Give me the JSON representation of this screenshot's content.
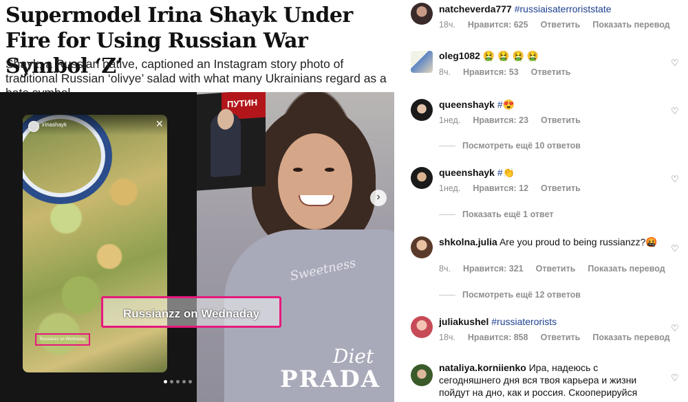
{
  "article": {
    "headline": "Supermodel Irina Shayk Under Fire for Using Russian War Symbol ‘Z’",
    "subheadline": "Shayk, a Russian native, captioned an Instagram story photo of traditional Russian ‘olivye’ salad with what many Ukrainians regard as a hate symbol.",
    "story_username": "irinashayk",
    "story_small_caption": "Russianzz on Wednaday",
    "highlighted_caption": "Russianzz on Wednaday",
    "book_title": "ПУТИН",
    "sweater_text": "Sweetness",
    "brand_top": "Diet",
    "brand_bottom": "PRADA",
    "carousel_dots_count": 5,
    "carousel_active_index": 0
  },
  "icons": {
    "close": "close-icon",
    "next": "chevron-right-icon",
    "heart": "heart-outline-icon"
  },
  "comments": [
    {
      "user": "natcheverda777",
      "text": "",
      "tag": "#russiaisaterroriststate",
      "time": "18ч.",
      "likes": "Нравится: 625",
      "reply": "Ответить",
      "translate": "Показать перевод"
    },
    {
      "user": "oleg1082",
      "text": "🤮 🤮 🤮 🤮",
      "tag": "",
      "time": "8ч.",
      "likes": "Нравится: 53",
      "reply": "Ответить",
      "translate": ""
    },
    {
      "user": "queenshayk",
      "text": "😍",
      "tag": "#",
      "time": "1нед.",
      "likes": "Нравится: 23",
      "reply": "Ответить",
      "translate": ""
    },
    {
      "user": "queenshayk",
      "text": "👏",
      "tag": "#",
      "time": "1нед.",
      "likes": "Нравится: 12",
      "reply": "Ответить",
      "translate": ""
    },
    {
      "user": "shkolna.julia",
      "text": "Are you proud to being russianzz?🤬",
      "tag": "",
      "time": "8ч.",
      "likes": "Нравится: 321",
      "reply": "Ответить",
      "translate": "Показать перевод"
    },
    {
      "user": "juliakushel",
      "text": "",
      "tag": "#russiaterorists",
      "time": "18ч.",
      "likes": "Нравится: 858",
      "reply": "Ответить",
      "translate": "Показать перевод"
    },
    {
      "user": "nataliya.korniienko",
      "text": "Ира, надеюсь с сегодняшнего дня вся твоя карьера и жизни пойдут на дно, как и россия. Скооперируйся",
      "tag": "",
      "time": "",
      "likes": "",
      "reply": "",
      "translate": ""
    }
  ],
  "more_replies": [
    "Посмотреть ещё 10 ответов",
    "Показать ещё 1 ответ",
    "Посмотреть ещё 12 ответов"
  ]
}
